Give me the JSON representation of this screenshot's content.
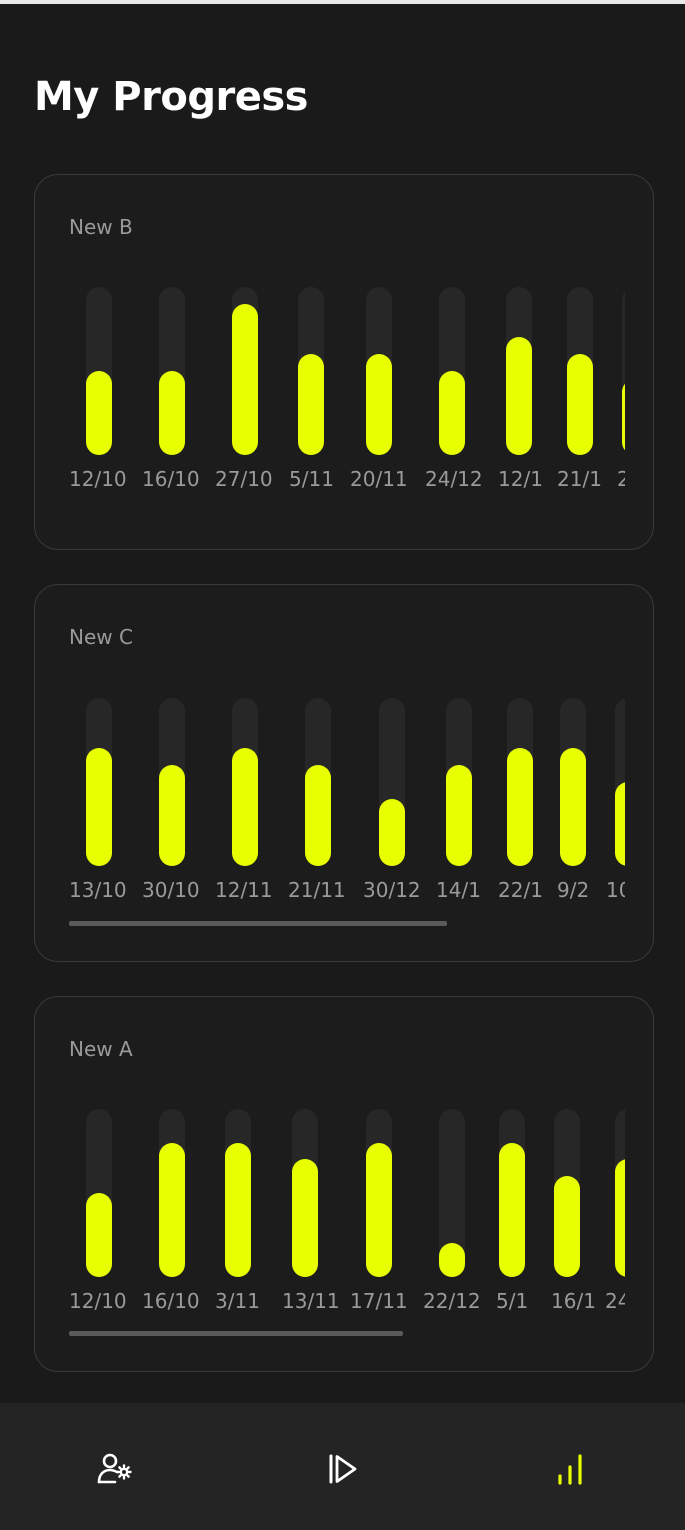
{
  "page": {
    "title": "My Progress"
  },
  "colors": {
    "accent": "#e7ff00",
    "background": "#1a1a1a",
    "track": "#272727",
    "label": "#9a9a9a"
  },
  "cards": [
    {
      "title": "New B",
      "chart_data": {
        "type": "bar",
        "categories": [
          "12/10",
          "16/10",
          "27/10",
          "5/11",
          "20/11",
          "24/12",
          "12/1",
          "21/1",
          "2"
        ],
        "values": [
          0.5,
          0.5,
          0.9,
          0.6,
          0.6,
          0.5,
          0.7,
          0.6,
          0.45
        ],
        "ylim": [
          0,
          1
        ]
      }
    },
    {
      "title": "New C",
      "chart_data": {
        "type": "bar",
        "categories": [
          "13/10",
          "30/10",
          "12/11",
          "21/11",
          "30/12",
          "14/1",
          "22/1",
          "9/2",
          "10"
        ],
        "values": [
          0.7,
          0.6,
          0.7,
          0.6,
          0.4,
          0.6,
          0.7,
          0.7,
          0.5
        ],
        "ylim": [
          0,
          1
        ]
      }
    },
    {
      "title": "New A",
      "chart_data": {
        "type": "bar",
        "categories": [
          "12/10",
          "16/10",
          "3/11",
          "13/11",
          "17/11",
          "22/12",
          "5/1",
          "16/1",
          "24"
        ],
        "values": [
          0.5,
          0.8,
          0.8,
          0.7,
          0.8,
          0.2,
          0.8,
          0.6,
          0.7
        ],
        "ylim": [
          0,
          1
        ]
      }
    }
  ],
  "nav": [
    {
      "name": "profile-settings",
      "icon": "user-gear-icon",
      "active": false
    },
    {
      "name": "play",
      "icon": "play-icon",
      "active": false
    },
    {
      "name": "progress",
      "icon": "bar-chart-icon",
      "active": true
    }
  ]
}
